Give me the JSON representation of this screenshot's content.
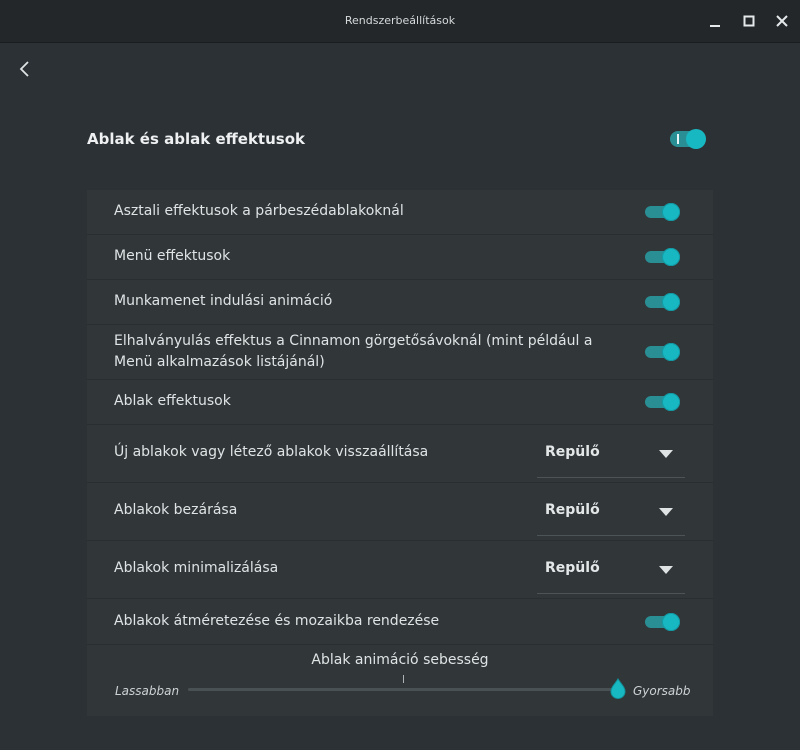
{
  "window": {
    "title": "Rendszerbeállítások",
    "controls": [
      "minimize-icon",
      "maximize-icon",
      "close-icon"
    ]
  },
  "section": {
    "title": "Ablak és ablak effektusok",
    "enabled": true
  },
  "rows": [
    {
      "label": "Asztali effektusok a párbeszédablakoknál",
      "type": "toggle",
      "on": true
    },
    {
      "label": "Menü effektusok",
      "type": "toggle",
      "on": true
    },
    {
      "label": "Munkamenet indulási animáció",
      "type": "toggle",
      "on": true
    },
    {
      "label": "Elhalványulás effektus a Cinnamon görgetősávoknál (mint például a Menü alkalmazások listájánál)",
      "type": "toggle",
      "on": true
    },
    {
      "label": "Ablak effektusok",
      "type": "toggle",
      "on": true
    },
    {
      "label": "Új ablakok vagy létező ablakok visszaállítása",
      "type": "dropdown",
      "value": "Repülő"
    },
    {
      "label": "Ablakok bezárása",
      "type": "dropdown",
      "value": "Repülő"
    },
    {
      "label": "Ablakok minimalizálása",
      "type": "dropdown",
      "value": "Repülő"
    },
    {
      "label": "Ablakok átméretezése és mozaikba rendezése",
      "type": "toggle",
      "on": true
    }
  ],
  "slider": {
    "title": "Ablak animáció sebesség",
    "min_label": "Lassabban",
    "max_label": "Gyorsabb",
    "value_fraction": 1.0
  },
  "colors": {
    "accent": "#18b8c3",
    "background": "#2b3134",
    "panel": "#313739",
    "titlebar": "#232729"
  }
}
